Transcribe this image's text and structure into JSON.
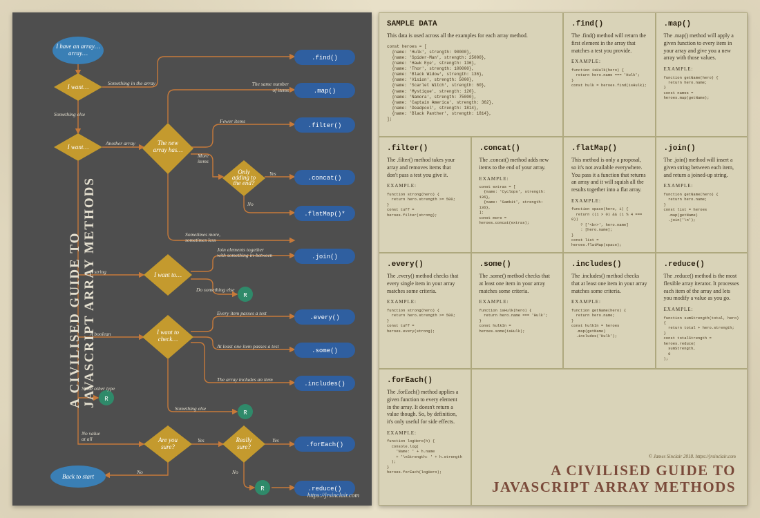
{
  "title_lines": "A CIVILISED GUIDE TO\nJAVASCRIPT ARRAY METHODS",
  "attribution": "https://jrsinclair.com",
  "credit": "© James Sinclair 2018. https://jrsinclair.com",
  "colors": {
    "bubble": "#3a7fb5",
    "diamond": "#c49a2e",
    "result": "#2f5fa0",
    "rnode": "#2f8a6a",
    "arrow": "#c77a3a",
    "ink": "#e4dfcf"
  },
  "nodes": {
    "start": "I have an array…",
    "want1": "I want…",
    "want2": "I want…",
    "newarrayhas": "The new array has…",
    "onlyend": "Only adding to the end?",
    "iwantto": "I want to…",
    "wantcheck": "I want to check…",
    "areyousure": "Are you sure?",
    "reallysure": "Really sure?",
    "back": "Back to start"
  },
  "edges": {
    "something_in_array": "Something in the array",
    "something_else": "Something else",
    "another_array": "Another array",
    "same_number": "The same number of items",
    "fewer_items": "Fewer items",
    "more_items": "More items",
    "sometimes": "Sometimes more, sometimes less",
    "a_string": "A string",
    "join_elements": "Join elements together with something in-between",
    "do_something_else": "Do something else",
    "a_boolean": "A boolean",
    "every_item": "Every item passes a test",
    "at_least_one": "At least one item passes a test",
    "array_includes": "The array includes an item",
    "some_other_type": "Some other type",
    "no_value": "No value at all",
    "something_else2": "Something else",
    "yes": "Yes",
    "no": "No"
  },
  "results": {
    "find": ".find()",
    "map": ".map()",
    "filter": ".filter()",
    "concat": ".concat()",
    "flatmap": ".flatMap()*",
    "join": ".join()",
    "every": ".every()",
    "some": ".some()",
    "includes": ".includes()",
    "foreach": ".forEach()",
    "reduce": ".reduce()",
    "r": "R"
  },
  "example_label": "EXAMPLE:",
  "cells": {
    "sample": {
      "title": "SAMPLE DATA",
      "desc": "This data is used across all the examples for each array method.",
      "code": "const heroes = [\n  {name: 'Hulk', strength: 90000},\n  {name: 'Spider-Man', strength: 25000},\n  {name: 'Hawk Eye', strength: 136},\n  {name: 'Thor', strength: 100000},\n  {name: 'Black Widow', strength: 136},\n  {name: 'Vision', strength: 5000},\n  {name: 'Scarlet Witch', strength: 60},\n  {name: 'Mystique', strength: 120},\n  {name: 'Namora', strength: 75000},\n  {name: 'Captain America', strength: 362},\n  {name: 'Deadpool', strength: 1814},\n  {name: 'Black Panther', strength: 1814},\n];"
    },
    "find": {
      "title": ".find()",
      "desc": "The .find() method will return the first element in the array that matches a test you provide.",
      "code": "function isHulk(hero) {\n  return hero.name === 'Hulk';\n}\nconst hulk = heroes.find(isHulk);"
    },
    "map": {
      "title": ".map()",
      "desc": "The .map() method will apply a given function to every item in your array and give you a new array with those values.",
      "code": "function getName(hero) {\n  return hero.name;\n}\nconst names = heroes.map(getName);"
    },
    "filter": {
      "title": ".filter()",
      "desc": "The .filter() method takes your array and removes items that don't pass a test you give it.",
      "code": "function strong(hero) {\n  return hero.strength >= 500;\n}\nconst tuff = heroes.filter(strong);"
    },
    "concat": {
      "title": ".concat()",
      "desc": "The .concat() method adds new items to the end of your array.",
      "code": "const extras = [\n  {name: 'Cyclops', strength: 136},\n  {name: 'Gambit', strength: 136},\n];\nconst more = heroes.concat(extras);"
    },
    "flatmap": {
      "title": ".flatMap()",
      "desc": "This method is only a proposal, so it's not available everywhere. You pass it a function that returns an array and it will squish all the results together into a flat array.",
      "code": "function space(hero, i) {\n  return ((i > 0) && (i % 4 === 0))\n    ? ['<br>', hero.name]\n    : [hero.name];\n}\nconst list = heroes.flatMap(space);"
    },
    "join": {
      "title": ".join()",
      "desc": "The .join() method will insert a given string between each item, and return a joined-up string.",
      "code": "function getName(hero) {\n  return hero.name;\n}\nconst list = heroes\n  .map(getName)\n  .join('\\n');"
    },
    "every": {
      "title": ".every()",
      "desc": "The .every() method checks that every single item in your array matches some criteria.",
      "code": "function strong(hero) {\n  return hero.strength >= 500;\n}\nconst tuff = heroes.every(strong);"
    },
    "some": {
      "title": ".some()",
      "desc": "The .some() method checks that at least one item in your array matches some criteria.",
      "code": "function isHulk(hero) {\n  return hero.name === 'Hulk';\n}\nconst hulkIn = heroes.some(isHulk);"
    },
    "includes": {
      "title": ".includes()",
      "desc": "The .includes() method checks that at least one item in your array matches some criteria.",
      "code": "function getName(hero) {\n  return hero.name;\n}\nconst hulkIn = heroes\n  .map(getName)\n  .includes('Hulk');"
    },
    "reduce": {
      "title": ".reduce()",
      "desc": "The .reduce() method is the most flexible array iterator. It processes each item of the array and lets you modify a value as you go.",
      "code": "function sumStrength(total, hero) {\n  return total + hero.strength;\n}\nconst totalStrength = heroes.reduce(\n  sumStrength,\n  0\n);"
    },
    "foreach": {
      "title": ".forEach()",
      "desc": "The .forEach() method applies a given function to every element in the array. It doesn't return a value though. So, by definition, it's only useful for side effects.",
      "code": "function logHero(h) {\n  console.log(\n    'Name: ' + h.name\n    + '\\nStrength: ' + h.strength\n  );\n}\nheroes.forEach(logHero);"
    }
  }
}
